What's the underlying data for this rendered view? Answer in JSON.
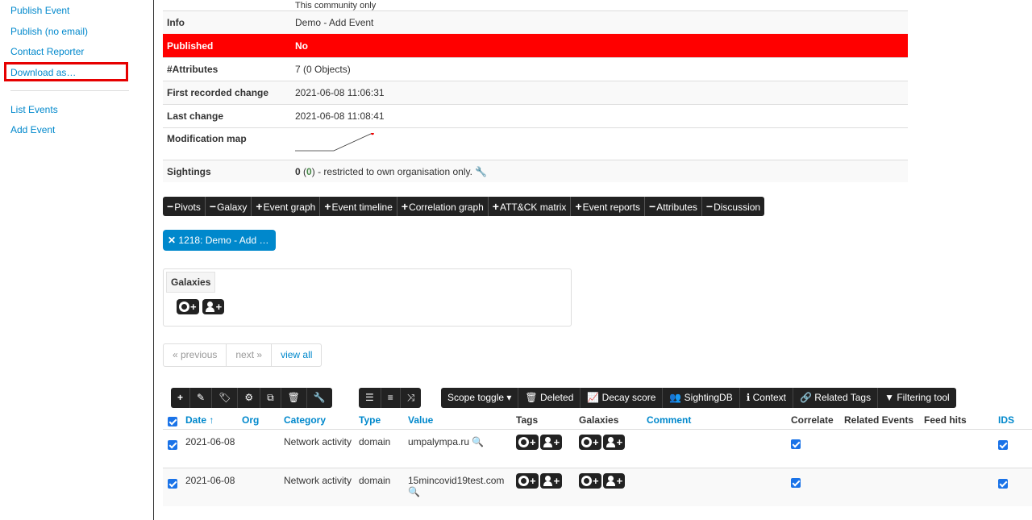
{
  "sidebar": {
    "items": [
      "Publish Event",
      "Publish (no email)",
      "Contact Reporter",
      "Download as…",
      "List Events",
      "Add Event"
    ]
  },
  "info": {
    "top_value": "This community only",
    "rows": [
      {
        "key": "Info",
        "value": "Demo - Add Event"
      },
      {
        "key": "Published",
        "value": "No"
      },
      {
        "key": "#Attributes",
        "value": "7 (0 Objects)"
      },
      {
        "key": "First recorded change",
        "value": "2021-06-08 11:06:31"
      },
      {
        "key": "Last change",
        "value": "2021-06-08 11:08:41"
      },
      {
        "key": "Modification map",
        "value": ""
      }
    ],
    "sightings": {
      "key": "Sightings",
      "count": "0",
      "own": "0",
      "note": "- restricted to own organisation only."
    }
  },
  "togglebar": [
    {
      "sym": "−",
      "label": "Pivots"
    },
    {
      "sym": "−",
      "label": "Galaxy"
    },
    {
      "sym": "+",
      "label": "Event graph"
    },
    {
      "sym": "+",
      "label": "Event timeline"
    },
    {
      "sym": "+",
      "label": "Correlation graph"
    },
    {
      "sym": "+",
      "label": "ATT&CK matrix"
    },
    {
      "sym": "+",
      "label": "Event reports"
    },
    {
      "sym": "−",
      "label": "Attributes"
    },
    {
      "sym": "−",
      "label": "Discussion"
    }
  ],
  "pivot": "1218: Demo - Add …",
  "galaxies": {
    "title": "Galaxies"
  },
  "pager": {
    "previous": "« previous",
    "next": "next »",
    "all": "view all"
  },
  "tools_right": [
    {
      "icon": "",
      "label": "Scope toggle ▾"
    },
    {
      "icon": "🗑",
      "label": "Deleted"
    },
    {
      "icon": "📈",
      "label": "Decay score"
    },
    {
      "icon": "👥",
      "label": "SightingDB"
    },
    {
      "icon": "ℹ",
      "label": "Context"
    },
    {
      "icon": "🔗",
      "label": "Related Tags"
    },
    {
      "icon": "▼",
      "label": "Filtering tool"
    }
  ],
  "table": {
    "headers": {
      "date": "Date ↑",
      "org": "Org",
      "category": "Category",
      "type": "Type",
      "value": "Value",
      "tags": "Tags",
      "galaxies": "Galaxies",
      "comment": "Comment",
      "correlate": "Correlate",
      "related": "Related Events",
      "feed": "Feed hits",
      "ids": "IDS"
    },
    "rows": [
      {
        "date": "2021-06-08",
        "category": "Network activity",
        "type": "domain",
        "value": "umpalympa.ru"
      },
      {
        "date": "2021-06-08",
        "category": "Network activity",
        "type": "domain",
        "value": "15mincovid19test.com"
      }
    ]
  }
}
